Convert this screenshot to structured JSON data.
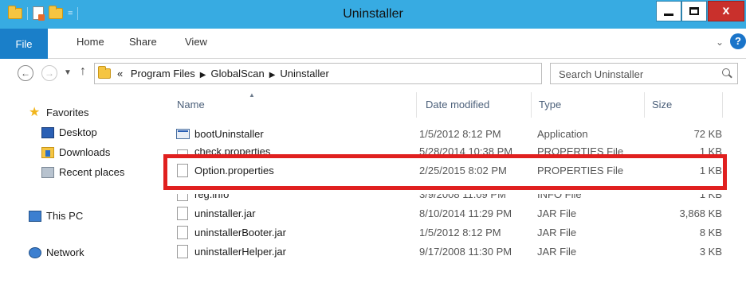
{
  "window": {
    "title": "Uninstaller",
    "qat_dropdown": "=",
    "close_glyph": "x"
  },
  "ribbon": {
    "tabs": [
      "File",
      "Home",
      "Share",
      "View"
    ],
    "expand_glyph": "⌄",
    "help_glyph": "?"
  },
  "nav": {
    "back_glyph": "←",
    "forward_glyph": "→",
    "recent_glyph": "▼",
    "up_glyph": "↑",
    "address": {
      "overflow": "«",
      "crumbs": [
        "Program Files",
        "GlobalScan",
        "Uninstaller"
      ],
      "dropdown_glyph": "⌄",
      "refresh_glyph": "↻"
    },
    "search": {
      "placeholder": "Search Uninstaller"
    }
  },
  "sidebar": {
    "items": [
      {
        "label": "Favorites",
        "icon": "star-icon"
      },
      {
        "label": "Desktop",
        "icon": "desktop-icon"
      },
      {
        "label": "Downloads",
        "icon": "downloads-icon"
      },
      {
        "label": "Recent places",
        "icon": "recent-places-icon"
      },
      {
        "label": "This PC",
        "icon": "this-pc-icon"
      },
      {
        "label": "Network",
        "icon": "network-icon"
      }
    ]
  },
  "files": {
    "columns": [
      "Name",
      "Date modified",
      "Type",
      "Size"
    ],
    "rows": [
      {
        "name": "bootUninstaller",
        "date": "1/5/2012 8:12 PM",
        "type": "Application",
        "size": "72 KB",
        "icon": "application-icon"
      },
      {
        "name": "check.properties",
        "date": "5/28/2014 10:38 PM",
        "type": "PROPERTIES File",
        "size": "1 KB",
        "icon": "file-icon"
      },
      {
        "name": "Option.properties",
        "date": "2/25/2015 8:02 PM",
        "type": "PROPERTIES File",
        "size": "1 KB",
        "icon": "file-icon"
      },
      {
        "name": "reg.info",
        "date": "3/9/2008 11:09 PM",
        "type": "INFO File",
        "size": "1 KB",
        "icon": "file-icon"
      },
      {
        "name": "uninstaller.jar",
        "date": "8/10/2014 11:29 PM",
        "type": "JAR File",
        "size": "3,868 KB",
        "icon": "file-icon"
      },
      {
        "name": "uninstallerBooter.jar",
        "date": "1/5/2012 8:12 PM",
        "type": "JAR File",
        "size": "8 KB",
        "icon": "file-icon"
      },
      {
        "name": "uninstallerHelper.jar",
        "date": "9/17/2008 11:30 PM",
        "type": "JAR File",
        "size": "3 KB",
        "icon": "file-icon"
      }
    ]
  },
  "colors": {
    "titlebar": "#37abe2",
    "file_tab": "#1a7fc9",
    "highlight_box": "#e0201f",
    "close_button": "#c9302c"
  }
}
